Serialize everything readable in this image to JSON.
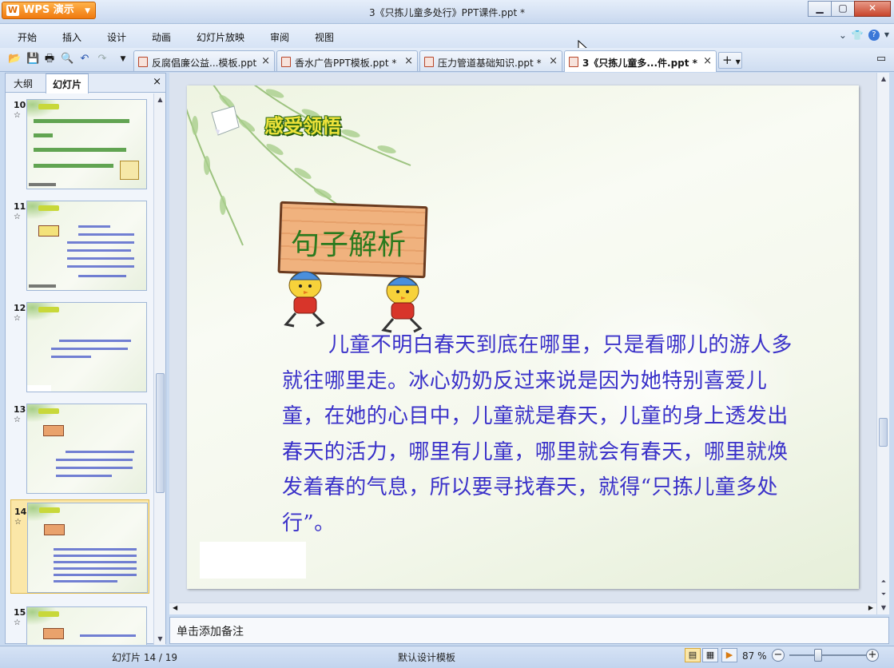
{
  "titlebar": {
    "app_button": "WPS 演示",
    "app_logo": "W",
    "window_title": "3《只拣儿童多处行》PPT课件.ppt *",
    "buttons": [
      "minimize",
      "maximize",
      "close"
    ]
  },
  "menu": {
    "items": [
      "开始",
      "插入",
      "设计",
      "动画",
      "幻灯片放映",
      "审阅",
      "视图"
    ],
    "right_icons": [
      "chevron-down-icon",
      "shirt-icon",
      "help-icon",
      "help-caret-icon"
    ]
  },
  "toolbar": {
    "tabs": [
      {
        "label": "反腐倡廉公益...模板.ppt",
        "active": false,
        "close": "×"
      },
      {
        "label": "香水广告PPT模板.ppt *",
        "active": false,
        "close": "×"
      },
      {
        "label": "压力管道基础知识.ppt *",
        "active": false,
        "close": "×"
      },
      {
        "label": "3《只拣儿童多...件.ppt *",
        "active": true,
        "close": "×"
      }
    ],
    "add_tab": "+"
  },
  "left_pane": {
    "tabs": [
      "大纲",
      "幻灯片"
    ],
    "active_tab": "幻灯片",
    "close": "×",
    "thumbnails": [
      {
        "number": "10",
        "star": "☆",
        "active": false
      },
      {
        "number": "11",
        "star": "☆",
        "active": false
      },
      {
        "number": "12",
        "star": "☆",
        "active": false
      },
      {
        "number": "13",
        "star": "☆",
        "active": false
      },
      {
        "number": "14",
        "star": "☆",
        "active": true
      },
      {
        "number": "15",
        "star": "☆",
        "active": false
      }
    ]
  },
  "slide": {
    "heading": "感受领悟",
    "board_text": "句子解析",
    "body": "儿童不明白春天到底在哪里，只是看哪儿的游人多就往哪里走。冰心奶奶反过来说是因为她特别喜爱儿童，在她的心目中，儿童就是春天，儿童的身上透发出春天的活力，哪里有儿童，哪里就会有春天，哪里就焕发着春的气息，所以要寻找春天，就得“只拣儿童多处行”。"
  },
  "notes": {
    "placeholder": "单击添加备注"
  },
  "statusbar": {
    "slide_counter": "幻灯片 14 / 19",
    "template": "默认设计模板",
    "zoom": "87 %",
    "zoom_minus": "−",
    "zoom_plus": "+",
    "zoom_level": 0.5
  },
  "colors": {
    "body_text": "#3a31c9",
    "heading_fill": "#ede23a",
    "board_text": "#2a7a1e",
    "accent_orange": "#f07a10"
  }
}
